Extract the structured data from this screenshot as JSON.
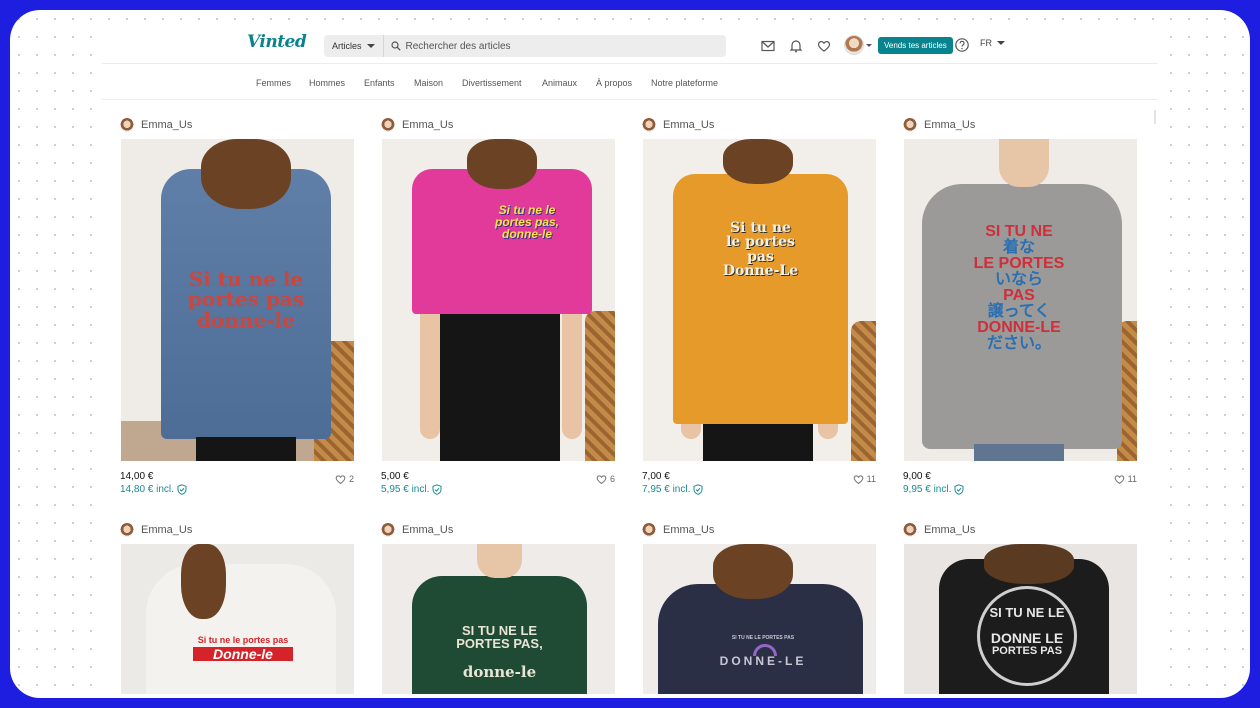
{
  "app": {
    "logo": "Vinted",
    "search": {
      "category": "Articles",
      "placeholder": "Rechercher des articles"
    },
    "sell_button": "Vends tes articles",
    "language": "FR"
  },
  "nav": [
    "Femmes",
    "Hommes",
    "Enfants",
    "Maison",
    "Divertissement",
    "Animaux",
    "À propos",
    "Notre plateforme"
  ],
  "colors": {
    "brand": "#09848f",
    "frame": "#1d1ee0"
  },
  "items": [
    {
      "seller": "Emma_Us",
      "price": "14,00 €",
      "price_incl": "14,80 € incl.",
      "favorites": "2",
      "graphic": [
        "Si tu ne le",
        "portes pas",
        "donne-le"
      ],
      "garment": "denim-jacket"
    },
    {
      "seller": "Emma_Us",
      "price": "5,00 €",
      "price_incl": "5,95 € incl.",
      "favorites": "6",
      "graphic": [
        "Si tu ne le",
        "portes pas,",
        "donne-le"
      ],
      "garment": "pink-tshirt"
    },
    {
      "seller": "Emma_Us",
      "price": "7,00 €",
      "price_incl": "7,95 € incl.",
      "favorites": "11",
      "graphic": [
        "Si tu ne",
        "le portes",
        "pas",
        "Donne-Le"
      ],
      "garment": "mustard-tshirt"
    },
    {
      "seller": "Emma_Us",
      "price": "9,00 €",
      "price_incl": "9,95 € incl.",
      "favorites": "11",
      "graphic": [
        "SI TU NE",
        "着な",
        "LE PORTES",
        "いなら",
        "PAS",
        "譲ってく",
        "DONNE-LE",
        "ださい。"
      ],
      "garment": "grey-sweatshirt"
    },
    {
      "seller": "Emma_Us",
      "graphic": [
        "Si tu ne le portes pas",
        "Donne-le"
      ],
      "garment": "white-hoodie"
    },
    {
      "seller": "Emma_Us",
      "graphic": [
        "SI TU NE LE",
        "PORTES PAS,",
        "donne-le"
      ],
      "garment": "green-sweatshirt"
    },
    {
      "seller": "Emma_Us",
      "graphic": [
        "SI TU NE LE PORTES PAS",
        "DONNE-LE"
      ],
      "garment": "navy-sweatshirt"
    },
    {
      "seller": "Emma_Us",
      "graphic": [
        "SI TU NE LE",
        "DONNE LE",
        "PORTES PAS"
      ],
      "garment": "leather-jacket"
    }
  ]
}
